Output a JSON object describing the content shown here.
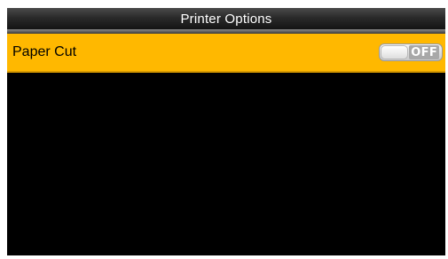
{
  "header": {
    "title": "Printer Options"
  },
  "menu": {
    "items": [
      {
        "label": "Paper Cut",
        "toggle_state": "OFF",
        "selected": true
      }
    ]
  },
  "colors": {
    "screen_background": "#000000",
    "highlight": "#ffb800",
    "title_bar": "#2a2a2a",
    "title_text": "#ffffff"
  },
  "icons": {
    "toggle": "toggle-switch-icon"
  }
}
